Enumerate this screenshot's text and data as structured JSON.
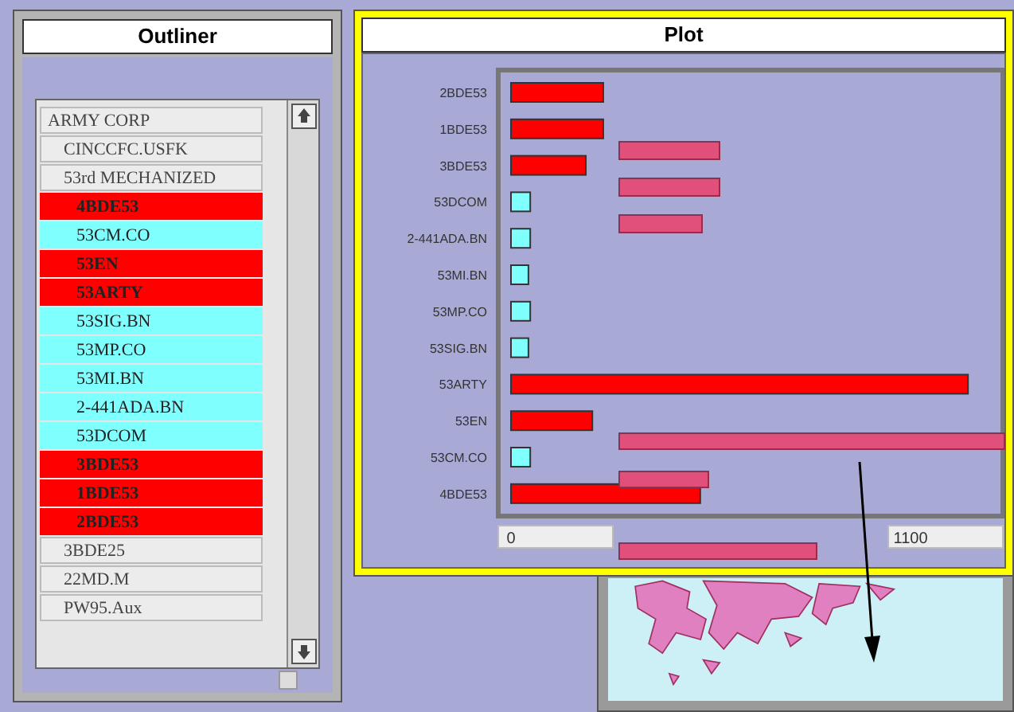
{
  "outliner": {
    "title": "Outliner",
    "items": [
      {
        "label": "ARMY CORP",
        "children": [
          {
            "label": "CINCCFC.USFK"
          },
          {
            "label": "53rd MECHANIZED",
            "children": [
              {
                "label": "4BDE53",
                "color": "#ff0000"
              },
              {
                "label": "53CM.CO",
                "color": "#80ffff"
              },
              {
                "label": "53EN",
                "color": "#ff0000"
              },
              {
                "label": "53ARTY",
                "color": "#ff0000"
              },
              {
                "label": "53SIG.BN",
                "color": "#80ffff"
              },
              {
                "label": "53MP.CO",
                "color": "#80ffff"
              },
              {
                "label": "53MI.BN",
                "color": "#80ffff"
              },
              {
                "label": "2-441ADA.BN",
                "color": "#80ffff"
              },
              {
                "label": "53DCOM",
                "color": "#80ffff"
              },
              {
                "label": "3BDE53",
                "color": "#ff0000"
              },
              {
                "label": "1BDE53",
                "color": "#ff0000"
              },
              {
                "label": "2BDE53",
                "color": "#ff0000"
              }
            ]
          },
          {
            "label": "3BDE25"
          },
          {
            "label": "22MD.M"
          },
          {
            "label": "PW95.Aux"
          }
        ]
      }
    ]
  },
  "plot": {
    "title": "Plot",
    "chart_data": {
      "type": "bar",
      "orientation": "horizontal",
      "stacked": false,
      "categories": [
        "2BDE53",
        "1BDE53",
        "3BDE53",
        "53DCOM",
        "2-441ADA.BN",
        "53MI.BN",
        "53MP.CO",
        "53SIG.BN",
        "53ARTY",
        "53EN",
        "53CM.CO",
        "4BDE53"
      ],
      "values": [
        254,
        254,
        206,
        53,
        53,
        48,
        53,
        48,
        1258,
        224,
        53,
        521
      ],
      "colors": [
        "#ff0000",
        "#ff0000",
        "#ff0000",
        "#80ffff",
        "#80ffff",
        "#80ffff",
        "#80ffff",
        "#80ffff",
        "#ff0000",
        "#ff0000",
        "#80ffff",
        "#ff0000"
      ],
      "xlim": [
        0,
        1354
      ],
      "xticks": [
        0,
        1100
      ]
    }
  }
}
